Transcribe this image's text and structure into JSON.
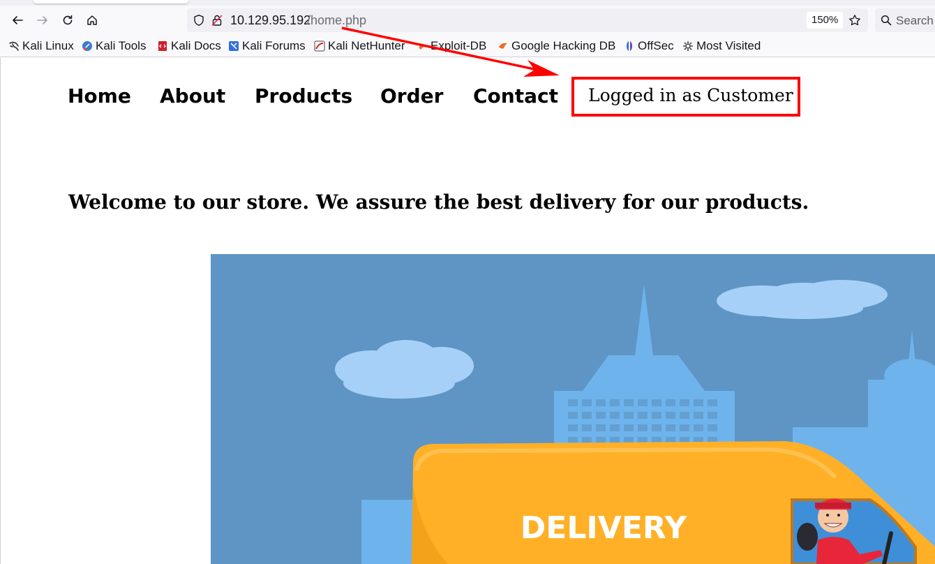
{
  "browser": {
    "url_host": "10.129.95.192",
    "url_path": "/home.php",
    "zoom": "150%",
    "search_placeholder": "Search",
    "icons": [
      "back-icon",
      "forward-icon",
      "reload-icon",
      "home-icon",
      "shield-icon",
      "insecure-lock-icon",
      "bookmark-star-icon",
      "search-icon"
    ]
  },
  "bookmarks": [
    {
      "label": "Kali Linux",
      "icon": "kali-dragon-icon"
    },
    {
      "label": "Kali Tools",
      "icon": "kali-tools-icon"
    },
    {
      "label": "Kali Docs",
      "icon": "kali-docs-icon"
    },
    {
      "label": "Kali Forums",
      "icon": "kali-forums-icon"
    },
    {
      "label": "Kali NetHunter",
      "icon": "nethunter-icon"
    },
    {
      "label": "Exploit-DB",
      "icon": "exploit-db-icon"
    },
    {
      "label": "Google Hacking DB",
      "icon": "ghdb-icon"
    },
    {
      "label": "OffSec",
      "icon": "offsec-icon"
    },
    {
      "label": "Most Visited",
      "icon": "gear-icon"
    }
  ],
  "site": {
    "nav": [
      "Home",
      "About",
      "Products",
      "Order",
      "Contact"
    ],
    "login_status": "Logged in as Customer",
    "welcome": "Welcome to our store. We assure the best delivery for our products.",
    "hero_van_text": "DELIVERY"
  },
  "colors": {
    "annotation_red": "#ff0000",
    "sky": "#5e95c4",
    "buildings": "#6fb3ec",
    "clouds": "#a6d0f7",
    "van": "#ffb027"
  }
}
